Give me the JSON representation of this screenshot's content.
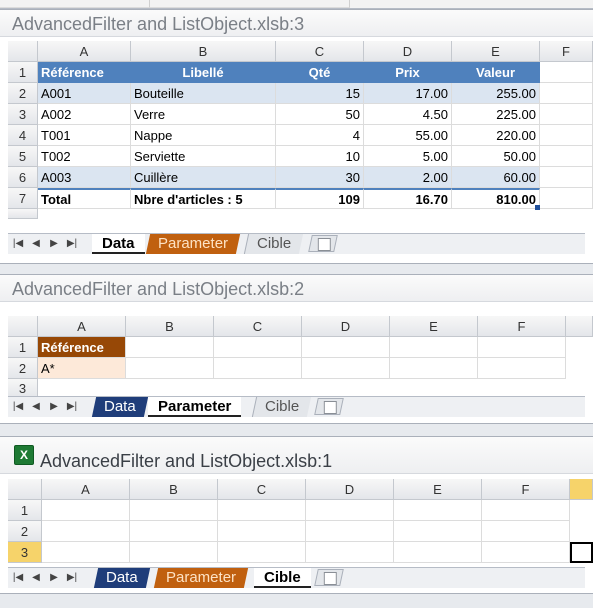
{
  "window3": {
    "title": "AdvancedFilter and ListObject.xlsb:3",
    "columns": [
      "A",
      "B",
      "C",
      "D",
      "E",
      "F"
    ],
    "rows": [
      "1",
      "2",
      "3",
      "4",
      "5",
      "6",
      "7"
    ],
    "header": [
      "Référence",
      "Libellé",
      "Qté",
      "Prix",
      "Valeur"
    ],
    "data": [
      [
        "A001",
        "Bouteille",
        "15",
        "17.00",
        "255.00"
      ],
      [
        "A002",
        "Verre",
        "50",
        "4.50",
        "225.00"
      ],
      [
        "T001",
        "Nappe",
        "4",
        "55.00",
        "220.00"
      ],
      [
        "T002",
        "Serviette",
        "10",
        "5.00",
        "50.00"
      ],
      [
        "A003",
        "Cuillère",
        "30",
        "2.00",
        "60.00"
      ]
    ],
    "total": [
      "Total",
      "Nbre d'articles :  5",
      "109",
      "16.70",
      "810.00"
    ],
    "tabs": [
      "Data",
      "Parameter",
      "Cible"
    ]
  },
  "window2": {
    "title": "AdvancedFilter and ListObject.xlsb:2",
    "columns": [
      "A",
      "B",
      "C",
      "D",
      "E",
      "F"
    ],
    "rows": [
      "1",
      "2",
      "3"
    ],
    "a1": "Référence",
    "a2": "A*",
    "tabs": [
      "Data",
      "Parameter",
      "Cible"
    ]
  },
  "window1": {
    "title": "AdvancedFilter and ListObject.xlsb:1",
    "columns": [
      "A",
      "B",
      "C",
      "D",
      "E",
      "F"
    ],
    "rows": [
      "1",
      "2",
      "3"
    ],
    "tabs": [
      "Data",
      "Parameter",
      "Cible"
    ],
    "icon": "excel-icon"
  },
  "nav_icons": [
    "first-sheet-icon",
    "prev-sheet-icon",
    "next-sheet-icon",
    "last-sheet-icon"
  ],
  "colors": {
    "header_blue": "#4f81bd",
    "band_blue": "#dbe5f1",
    "header_brown": "#974806",
    "peach": "#fde9d9"
  }
}
